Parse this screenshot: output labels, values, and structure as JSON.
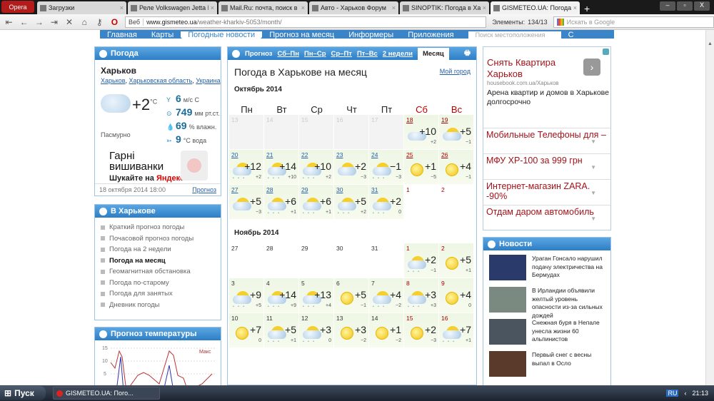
{
  "browser": {
    "menu_label": "Opera",
    "tabs": [
      {
        "title": "Загрузки"
      },
      {
        "title": "Реле Volkswagen Jetta I..."
      },
      {
        "title": "Mail.Ru: почта, поиск в ..."
      },
      {
        "title": "Авто - Харьков Форум"
      },
      {
        "title": "SINOPTIK: Погода в Ха..."
      },
      {
        "title": "GISMETEO.UA: Погода ...",
        "active": true
      }
    ],
    "address_prefix": "Веб",
    "url_domain": "www.gismeteo.ua",
    "url_path": "/weather-kharkiv-5053/month/",
    "elements_label": "Элементы:",
    "elements_value": "134/13",
    "search_placeholder": "Искать в Google"
  },
  "site_nav": {
    "items": [
      "Главная",
      "Карты",
      "Погодные новости",
      "Прогноз на месяц",
      "Информеры",
      "Приложения"
    ],
    "search_placeholder": "Поиск местоположения",
    "search_button": "С"
  },
  "weather": {
    "header": "Погода",
    "city": "Харьков",
    "crumbs": [
      "Харьков",
      "Харьковская область",
      "Украина"
    ],
    "temp": "+2",
    "temp_unit": "°C",
    "condition": "Пасмурно",
    "wind_value": "6",
    "wind_unit": "м/с  С",
    "pressure_value": "749",
    "pressure_unit": "мм рт.ст.",
    "humidity_value": "69",
    "humidity_unit": "% влажн.",
    "water_value": "9",
    "water_unit": "°С вода",
    "ad_title": "Гарні вишиванки",
    "ad_sub_prefix": "Шукайте на ",
    "ad_sub_brand": "Яндексі",
    "updated": "18 октября 2014 18:00",
    "forecast_link": "Прогноз"
  },
  "city_menu": {
    "header": "В Харькове",
    "items": [
      "Краткий прогноз погоды",
      "Почасовой прогноз погоды",
      "Погода на 2 недели",
      "Погода на месяц",
      "Геомагнитная обстановка",
      "Погода по-старому",
      "Погода для занятых",
      "Дневник погоды"
    ],
    "current_index": 3
  },
  "temp_chart": {
    "header": "Прогноз температуры",
    "y_ticks": [
      "15",
      "10",
      "5"
    ],
    "legend_max": "Макс"
  },
  "calendar": {
    "tab_label": "Прогноз",
    "tabs": [
      "Сб–Пн",
      "Пн–Ср",
      "Ср–Пт",
      "Пт–Вс",
      "2 недели"
    ],
    "active_tab": "Месяц",
    "title": "Погода в Харькове на месяц",
    "my_city": "Мой город",
    "dows": [
      "Пн",
      "Вт",
      "Ср",
      "Чт",
      "Пт",
      "Сб",
      "Вс"
    ],
    "months": [
      {
        "name": "Октябрь 2014",
        "days": [
          {
            "d": "13",
            "empty": true
          },
          {
            "d": "14",
            "empty": true
          },
          {
            "d": "15",
            "empty": true
          },
          {
            "d": "16",
            "empty": true
          },
          {
            "d": "17",
            "empty": true
          },
          {
            "d": "18",
            "hi": "+10",
            "lo": "+2",
            "icon": "cloud"
          },
          {
            "d": "19",
            "hi": "+5",
            "lo": "−1",
            "icon": "partly"
          },
          {
            "d": "20",
            "hi": "+12",
            "lo": "+2",
            "icon": "partly-rain"
          },
          {
            "d": "21",
            "hi": "+14",
            "lo": "+10",
            "icon": "partly-rain"
          },
          {
            "d": "22",
            "hi": "+10",
            "lo": "+2",
            "icon": "partly-rain"
          },
          {
            "d": "23",
            "hi": "+2",
            "lo": "−3",
            "icon": "partly"
          },
          {
            "d": "24",
            "hi": "−1",
            "lo": "−3",
            "icon": "partly-rain"
          },
          {
            "d": "25",
            "hi": "+1",
            "lo": "−5",
            "icon": "sun"
          },
          {
            "d": "26",
            "hi": "+4",
            "lo": "−1",
            "icon": "sun"
          },
          {
            "d": "27",
            "hi": "+5",
            "lo": "−3",
            "icon": "partly"
          },
          {
            "d": "28",
            "hi": "+6",
            "lo": "+1",
            "icon": "partly-rain"
          },
          {
            "d": "29",
            "hi": "+6",
            "lo": "+1",
            "icon": "partly-rain"
          },
          {
            "d": "30",
            "hi": "+5",
            "lo": "+2",
            "icon": "partly-rain"
          },
          {
            "d": "31",
            "hi": "+2",
            "lo": "0",
            "icon": "partly-rain"
          },
          {
            "d": "1",
            "emptyw": true
          },
          {
            "d": "2",
            "emptyw": true
          }
        ]
      },
      {
        "name": "Ноябрь 2014",
        "days": [
          {
            "d": "27",
            "emptyw": true
          },
          {
            "d": "28",
            "emptyw": true
          },
          {
            "d": "29",
            "emptyw": true
          },
          {
            "d": "30",
            "emptyw": true
          },
          {
            "d": "31",
            "emptyw": true
          },
          {
            "d": "1",
            "hi": "+2",
            "lo": "−1",
            "icon": "partly-rain"
          },
          {
            "d": "2",
            "hi": "+5",
            "lo": "+1",
            "icon": "sun"
          },
          {
            "d": "3",
            "hi": "+9",
            "lo": "+5",
            "icon": "partly-rain"
          },
          {
            "d": "4",
            "hi": "+14",
            "lo": "+9",
            "icon": "partly-rain"
          },
          {
            "d": "5",
            "hi": "+13",
            "lo": "+4",
            "icon": "partly-rain"
          },
          {
            "d": "6",
            "hi": "+5",
            "lo": "−1",
            "icon": "sun"
          },
          {
            "d": "7",
            "hi": "+4",
            "lo": "−2",
            "icon": "partly-rain"
          },
          {
            "d": "8",
            "hi": "+3",
            "lo": "+3",
            "icon": "partly-rain"
          },
          {
            "d": "9",
            "hi": "+4",
            "lo": "0",
            "icon": "sun"
          },
          {
            "d": "10",
            "hi": "+7",
            "lo": "0",
            "icon": "sun"
          },
          {
            "d": "11",
            "hi": "+5",
            "lo": "+1",
            "icon": "partly-rain"
          },
          {
            "d": "12",
            "hi": "+3",
            "lo": "0",
            "icon": "partly-rain"
          },
          {
            "d": "13",
            "hi": "+3",
            "lo": "−2",
            "icon": "sun"
          },
          {
            "d": "14",
            "hi": "+1",
            "lo": "−2",
            "icon": "sun"
          },
          {
            "d": "15",
            "hi": "+2",
            "lo": "−3",
            "icon": "sun"
          },
          {
            "d": "16",
            "hi": "+7",
            "lo": "+1",
            "icon": "partly-rain"
          }
        ]
      }
    ]
  },
  "ads": {
    "main_title": "Снять Квартира Харьков",
    "main_domain": "housebook.com.ua/Харьков",
    "main_desc": "Арена квартир и домов в Харькове долгосрочно",
    "links": [
      "Мобильные Телефоны для –",
      "МФУ XP-100 за 999 грн",
      "Интернет-магазин ZARA. -90%",
      "Отдам даром автомобиль"
    ]
  },
  "news": {
    "header": "Новости",
    "items": [
      {
        "title": "Ураган Гонсало нарушил подачу электричества на Бермудах",
        "color": "#2a3a6a"
      },
      {
        "title": "В Ирландии объявили желтый уровень опасности из-за сильных дождей",
        "color": "#7a8a80"
      },
      {
        "title": "Снежная буря в Непале унесла жизни 60 альпинистов",
        "color": "#4a5560"
      },
      {
        "title": "Первый снег с весны выпал в Осло",
        "color": "#5a3a2a"
      }
    ]
  },
  "taskbar": {
    "start": "Пуск",
    "task": "GISMETEO.UA: Пого...",
    "lang": "RU",
    "clock": "21:13"
  }
}
